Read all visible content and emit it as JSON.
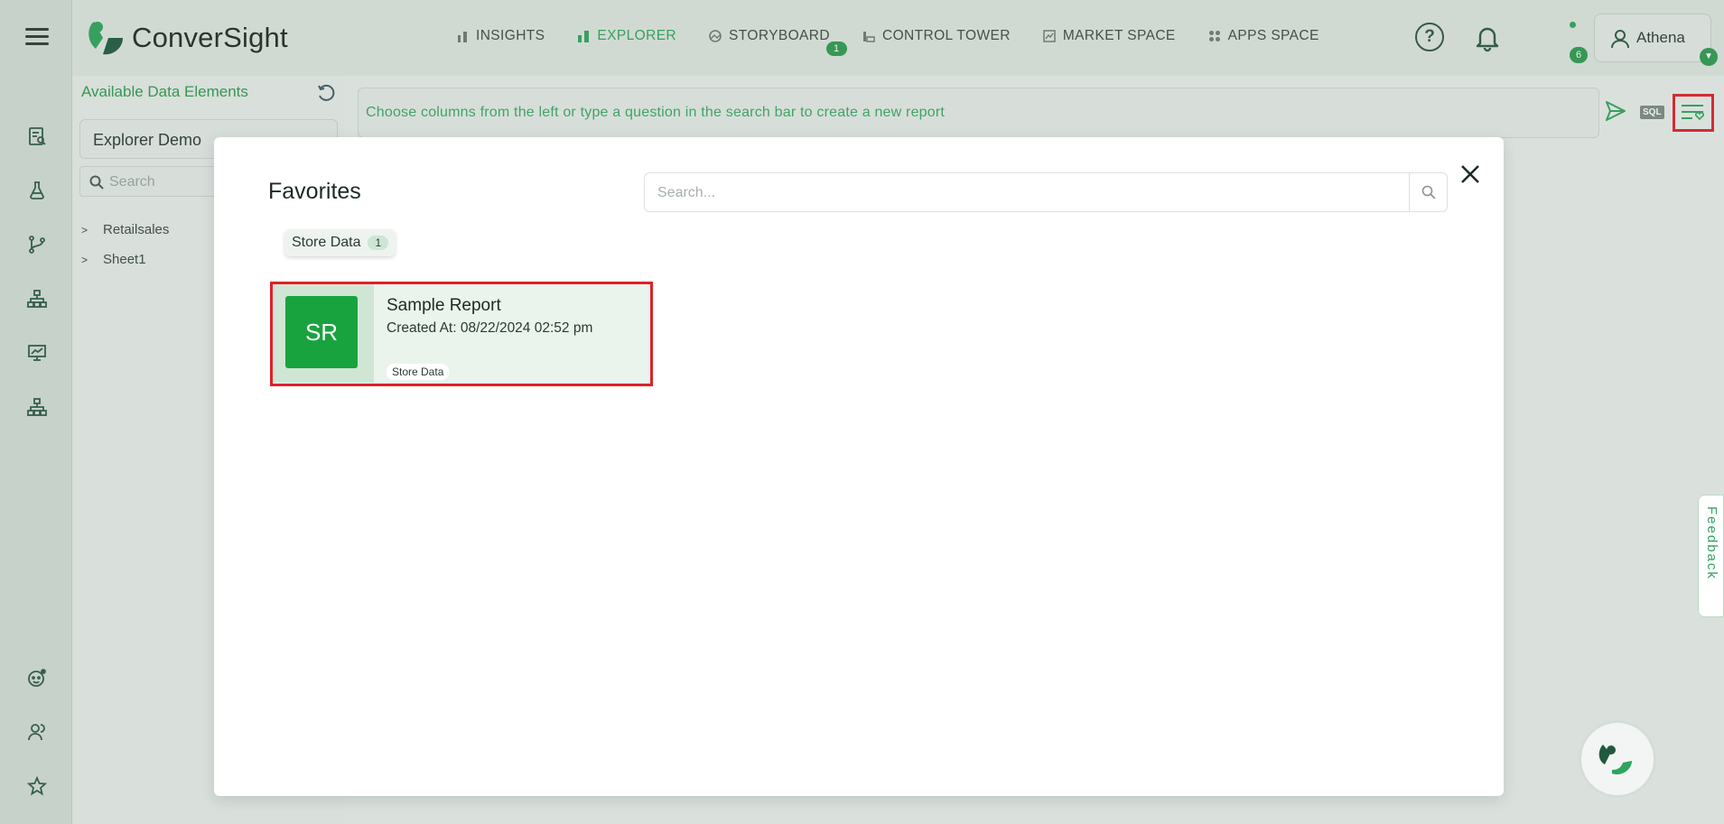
{
  "app": {
    "brand": "ConverSight"
  },
  "nav": {
    "items": [
      {
        "label": "INSIGHTS",
        "active": false
      },
      {
        "label": "EXPLORER",
        "active": true
      },
      {
        "label": "STORYBOARD",
        "active": false,
        "badge": "1"
      },
      {
        "label": "CONTROL TOWER",
        "active": false
      },
      {
        "label": "MARKET SPACE",
        "active": false
      },
      {
        "label": "APPS SPACE",
        "active": false
      }
    ]
  },
  "header": {
    "notifications_count": "6",
    "user_name": "Athena"
  },
  "left_panel": {
    "title": "Available Data Elements",
    "dataset_selected": "Explorer Demo",
    "search_placeholder": "Search",
    "tree": [
      {
        "label": "Retailsales"
      },
      {
        "label": "Sheet1"
      }
    ]
  },
  "query_bar": {
    "placeholder": "Choose columns from the left or type a question in the search bar to create a new report",
    "sql_label": "SQL"
  },
  "modal": {
    "title": "Favorites",
    "search_placeholder": "Search...",
    "chip": {
      "label": "Store Data",
      "count": "1"
    },
    "cards": [
      {
        "initials": "SR",
        "name": "Sample Report",
        "created": "Created At: 08/22/2024 02:52 pm",
        "tag": "Store Data"
      }
    ]
  },
  "feedback_label": "Feedback",
  "colors": {
    "accent": "#2ea45c",
    "highlight": "#e0202a",
    "avatar": "#18a33f"
  }
}
